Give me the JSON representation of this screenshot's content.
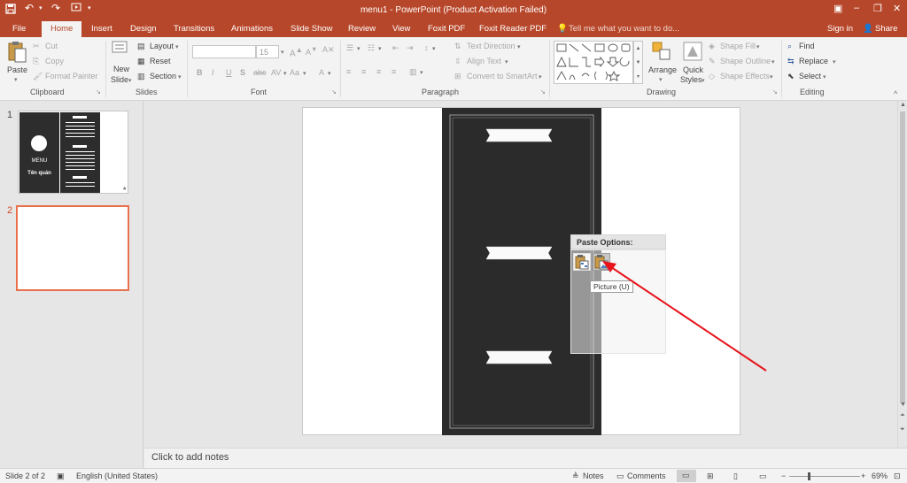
{
  "window": {
    "title": "menu1 - PowerPoint (Product Activation Failed)",
    "sign_in": "Sign in",
    "share": "Share"
  },
  "tabs": [
    "File",
    "Home",
    "Insert",
    "Design",
    "Transitions",
    "Animations",
    "Slide Show",
    "Review",
    "View",
    "Foxit PDF",
    "Foxit Reader PDF"
  ],
  "tell_me": "Tell me what you want to do...",
  "ribbon": {
    "clipboard": {
      "label": "Clipboard",
      "paste": "Paste",
      "cut": "Cut",
      "copy": "Copy",
      "format_painter": "Format Painter"
    },
    "slides": {
      "label": "Slides",
      "new_slide": "New",
      "new_slide2": "Slide",
      "layout": "Layout",
      "reset": "Reset",
      "section": "Section"
    },
    "font": {
      "label": "Font",
      "font_size": "15"
    },
    "paragraph": {
      "label": "Paragraph",
      "text_direction": "Text Direction",
      "align_text": "Align Text",
      "convert_smartart": "Convert to SmartArt"
    },
    "drawing": {
      "label": "Drawing",
      "arrange": "Arrange",
      "quick": "Quick",
      "styles": "Styles",
      "shape_fill": "Shape Fill",
      "shape_outline": "Shape Outline",
      "shape_effects": "Shape Effects"
    },
    "editing": {
      "label": "Editing",
      "find": "Find",
      "replace": "Replace",
      "select": "Select"
    }
  },
  "thumbnails": [
    {
      "number": "1",
      "menu_text": "MENU",
      "shop_text": "Tên quán"
    },
    {
      "number": "2"
    }
  ],
  "paste_options": {
    "title": "Paste Options:",
    "tooltip": "Picture (U)"
  },
  "notes_placeholder": "Click to add notes",
  "status": {
    "slide": "Slide 2 of 2",
    "language": "English (United States)",
    "notes": "Notes",
    "comments": "Comments",
    "zoom": "69%"
  },
  "colors": {
    "accent": "#b7472a",
    "chalkboard": "#2b2b2b",
    "arrow": "#e8131b"
  }
}
